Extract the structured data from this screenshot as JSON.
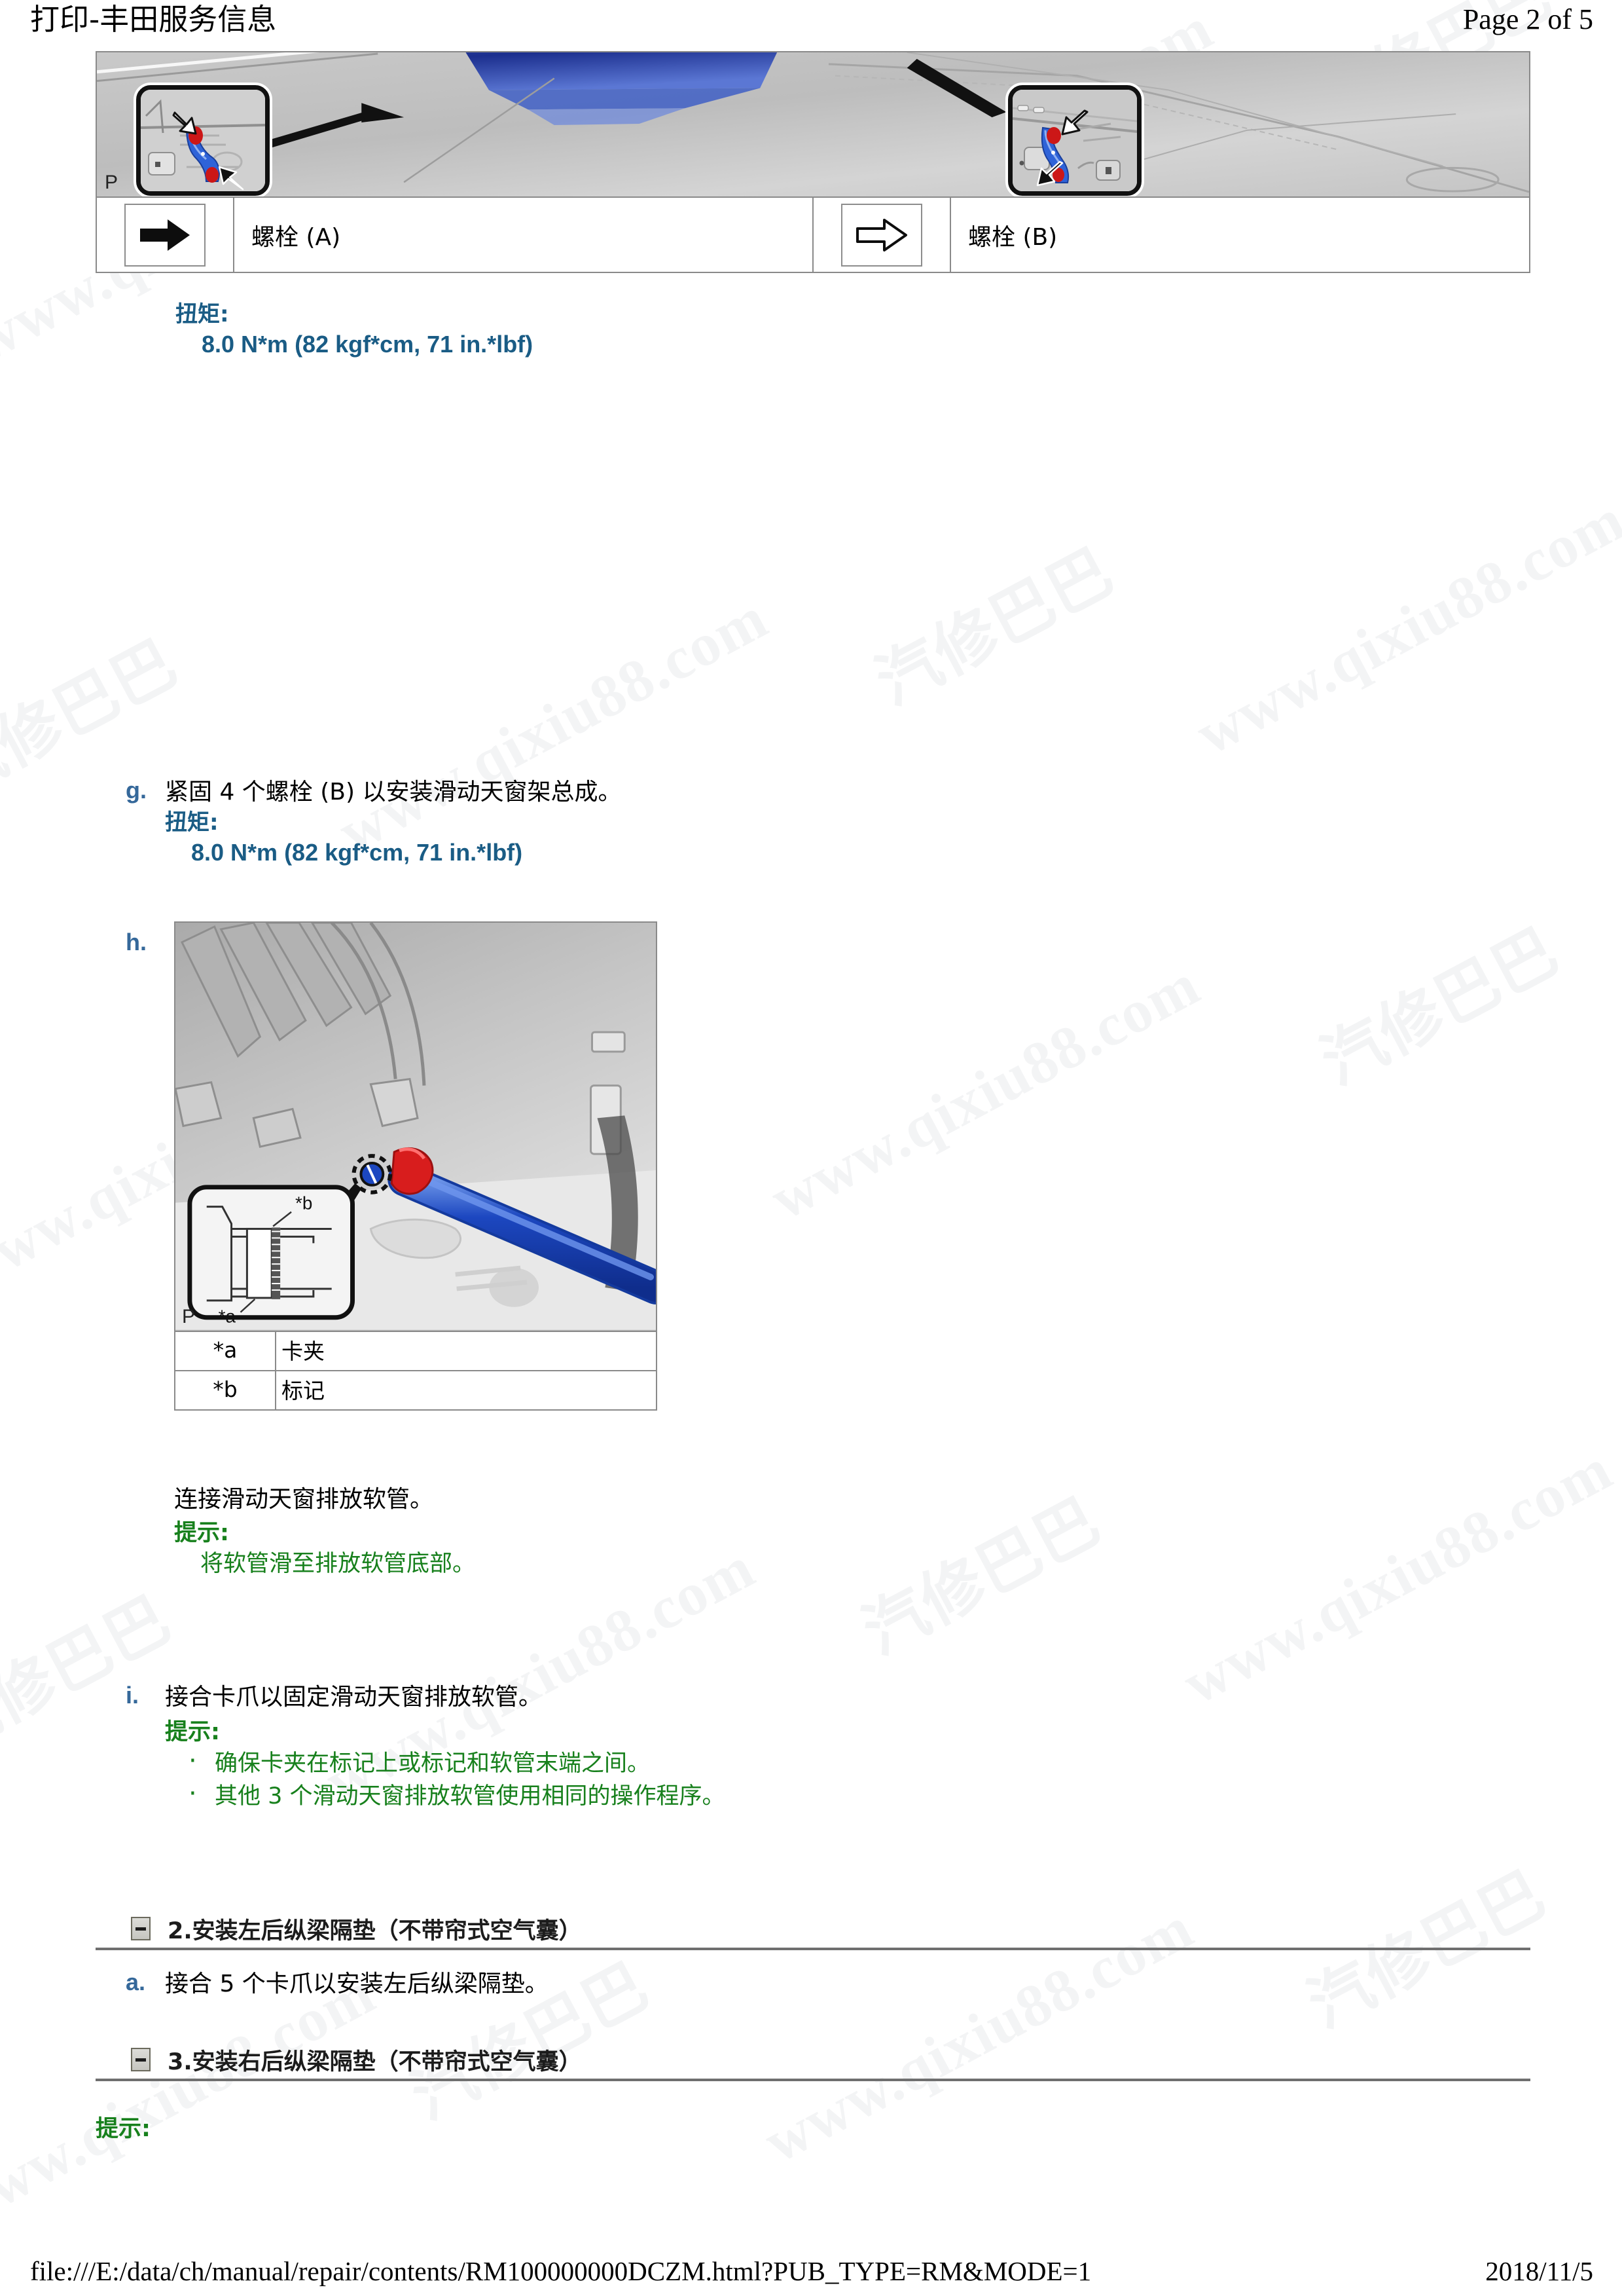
{
  "header": {
    "title": "打印-丰田服务信息",
    "page_label": "Page 2 of 5"
  },
  "figure1": {
    "corner_mark": "P",
    "description": "滑动天窗架总成安装位置示意图（带左右放大插图）"
  },
  "legend": {
    "items": [
      {
        "icon": "solid-arrow-icon",
        "label": "螺栓 (A)"
      },
      {
        "icon": "hollow-arrow-icon",
        "label": "螺栓 (B)"
      }
    ]
  },
  "torque_top": {
    "label": "扭矩:",
    "value": "8.0 N*m (82 kgf*cm, 71 in.*lbf)"
  },
  "step_g": {
    "marker": "g.",
    "text": "紧固 4 个螺栓 (B) 以安装滑动天窗架总成。",
    "torque_label": "扭矩:",
    "torque_value": "8.0 N*m (82 kgf*cm, 71 in.*lbf)"
  },
  "step_h": {
    "marker": "h.",
    "figure": {
      "corner_mark": "P",
      "annotations": [
        "*a",
        "*b"
      ]
    },
    "table": {
      "rows": [
        {
          "key": "*a",
          "value": "卡夹"
        },
        {
          "key": "*b",
          "value": "标记"
        }
      ]
    },
    "text": "连接滑动天窗排放软管。",
    "hint_label": "提示:",
    "hint_text": "将软管滑至排放软管底部。"
  },
  "step_i": {
    "marker": "i.",
    "text": "接合卡爪以固定滑动天窗排放软管。",
    "hint_label": "提示:",
    "hint_bullets": [
      "确保卡夹在标记上或标记和软管末端之间。",
      "其他 3 个滑动天窗排放软管使用相同的操作程序。"
    ]
  },
  "section2": {
    "title": "2.安装左后纵梁隔垫（不带帘式空气囊）",
    "toggle": "collapse-minus-icon",
    "step_a": {
      "marker": "a.",
      "text": "接合 5 个卡爪以安装左后纵梁隔垫。"
    }
  },
  "section3": {
    "title": "3.安装右后纵梁隔垫（不带帘式空气囊）",
    "toggle": "collapse-minus-icon",
    "hint_label": "提示:"
  },
  "footer": {
    "url": "file:///E:/data/ch/manual/repair/contents/RM100000000DCZM.html?PUB_TYPE=RM&MODE=1",
    "date": "2018/11/5"
  },
  "watermark": {
    "text_en": "www.qixiu88.com",
    "text_cn": "汽修巴巴"
  },
  "colors": {
    "torque_blue": "#1a5c85",
    "step_marker_blue": "#35689a",
    "hint_green": "#17801c",
    "rule_gray": "#8a8a8a",
    "part_blue": "#2b5fd0",
    "part_red": "#d21b1b"
  }
}
